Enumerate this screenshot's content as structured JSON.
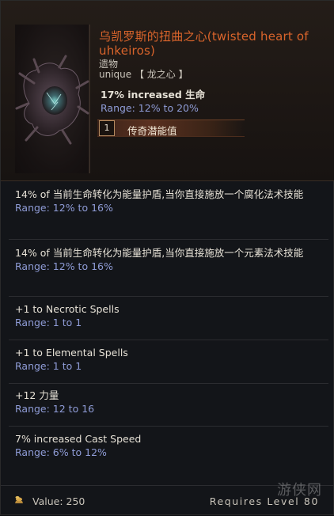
{
  "item": {
    "title": "乌凯罗斯的扭曲之心(twisted heart of uhkeiros)",
    "base_type": "遗物",
    "rarity_line": "unique 【 龙之心 】",
    "implicit": "17% increased 生命",
    "implicit_range": "Range: 12% to 20%",
    "legendary_potential_number": "1",
    "legendary_potential_label": "传奇潜能值",
    "icon": "twisted-heart-relic-icon"
  },
  "affixes": [
    {
      "text": "14% of 当前生命转化为能量护盾,当你直接施放一个腐化法术技能",
      "range": "Range: 12% to 16%"
    },
    {
      "text": "14% of 当前生命转化为能量护盾,当你直接施放一个元素法术技能",
      "range": "Range: 12% to 16%"
    },
    {
      "text": "+1 to Necrotic Spells",
      "range": "Range: 1 to 1"
    },
    {
      "text": "+1 to Elemental Spells",
      "range": "Range: 1 to 1"
    },
    {
      "text": "+12 力量",
      "range": "Range: 12 to 16"
    },
    {
      "text": "7% increased Cast Speed",
      "range": "Range: 6% to 12%"
    }
  ],
  "footer": {
    "value": "Value: 250",
    "requires": "Requires Level 80",
    "coin_icon": "gold-coin-icon"
  },
  "watermark": "游侠网",
  "colors": {
    "title": "#d9642b",
    "range": "#8f9cd7",
    "text": "#e6e1d6",
    "background": "#131519"
  }
}
